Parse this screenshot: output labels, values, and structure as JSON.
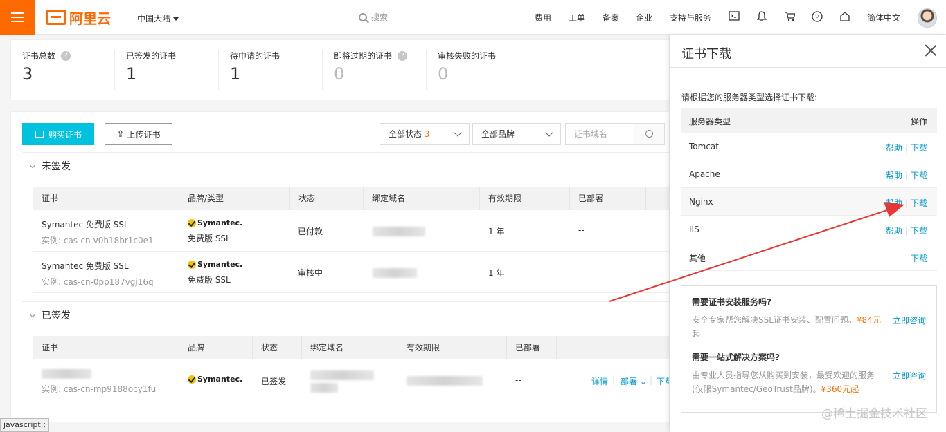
{
  "topbar": {
    "region": "中国大陆",
    "search_placeholder": "搜索",
    "nav": [
      "费用",
      "工单",
      "备案",
      "企业",
      "支持与服务"
    ],
    "language": "简体中文"
  },
  "stats": [
    {
      "label": "证书总数",
      "value": "3",
      "help": true
    },
    {
      "label": "已签发的证书",
      "value": "1"
    },
    {
      "label": "待申请的证书",
      "value": "1"
    },
    {
      "label": "即将过期的证书",
      "value": "0",
      "help": true
    },
    {
      "label": "审核失败的证书",
      "value": "0"
    }
  ],
  "toolbar": {
    "buy_label": "购买证书",
    "upload_label": "上传证书",
    "status_filter": "全部状态",
    "status_count": "3",
    "brand_filter": "全部品牌",
    "domain_placeholder": "证书域名"
  },
  "unsigned": {
    "title": "未签发",
    "columns": [
      "证书",
      "品牌/类型",
      "状态",
      "绑定域名",
      "有效期限",
      "已部署"
    ],
    "rows": [
      {
        "name": "Symantec 免费版 SSL",
        "instance": "实例: cas-cn-v0h18br1c0e1",
        "brand": "Symantec.",
        "type": "免费版 SSL",
        "status": "已付款",
        "period": "1 年",
        "deployed": "--"
      },
      {
        "name": "Symantec 免费版 SSL",
        "instance": "实例: cas-cn-0pp187vgj16q",
        "brand": "Symantec.",
        "type": "免费版 SSL",
        "status": "审核中",
        "period": "1 年",
        "deployed": "--"
      }
    ]
  },
  "signed": {
    "title": "已签发",
    "columns": [
      "证书",
      "品牌",
      "状态",
      "绑定域名",
      "有效期限",
      "已部署"
    ],
    "rows": [
      {
        "instance": "实例: cas-cn-mp9188ocy1fu",
        "brand": "Symantec.",
        "status": "已签发",
        "deployed": "--",
        "action_detail": "详情",
        "action_deploy": "部署",
        "action_download": "下载"
      }
    ]
  },
  "drawer": {
    "title": "证书下载",
    "hint": "请根据您的服务器类型选择证书下载:",
    "col_server": "服务器类型",
    "col_action": "操作",
    "help_label": "帮助",
    "download_label": "下载",
    "servers": [
      {
        "name": "Tomcat",
        "help": true
      },
      {
        "name": "Apache",
        "help": true
      },
      {
        "name": "Nginx",
        "help": true
      },
      {
        "name": "IIS",
        "help": true
      },
      {
        "name": "其他",
        "help": false
      }
    ],
    "promo": [
      {
        "title": "需要证书安装服务吗?",
        "desc": "安全专家帮您解决SSL证书安装、配置问题。",
        "price": "¥84元",
        "tail": "起",
        "cta": "立即咨询"
      },
      {
        "title": "需要一站式解决方案吗?",
        "desc": "由专业人员指导您从购买到安装，最受欢迎的服务(仅限Symantec/GeoTrust品牌)。",
        "price": "¥360元起",
        "tail": "",
        "cta": "立即咨询"
      }
    ]
  },
  "watermark": "@稀土掘金技术社区",
  "status_tip": "javascript:;",
  "colors": {
    "accent": "#ff6a00",
    "primary": "#00c1de",
    "link": "#0099cc",
    "arrow": "#e53935"
  }
}
